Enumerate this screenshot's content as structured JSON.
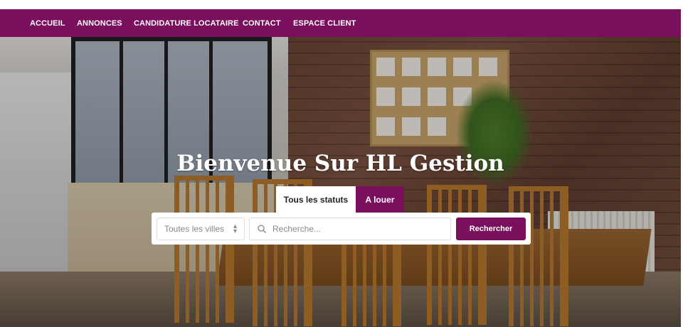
{
  "nav": {
    "items": [
      {
        "label": "ACCUEIL"
      },
      {
        "label": "ANNONCES"
      },
      {
        "label": "CANDIDATURE LOCATAIRE"
      },
      {
        "label": "CONTACT"
      },
      {
        "label": "ESPACE CLIENT"
      }
    ]
  },
  "hero": {
    "title": "Bienvenue Sur HL Gestion"
  },
  "search": {
    "tabs": [
      {
        "label": "Tous les statuts",
        "active": false
      },
      {
        "label": "A louer",
        "active": true
      }
    ],
    "city_select": {
      "selected": "Toutes les villes"
    },
    "query": {
      "placeholder": "Recherche...",
      "value": ""
    },
    "submit_label": "Rechercher"
  },
  "colors": {
    "brand": "#7a0f5e",
    "nav_text": "#ffffff"
  },
  "icons": {
    "city_select": "chevron-up-down-icon",
    "search": "search-icon"
  }
}
